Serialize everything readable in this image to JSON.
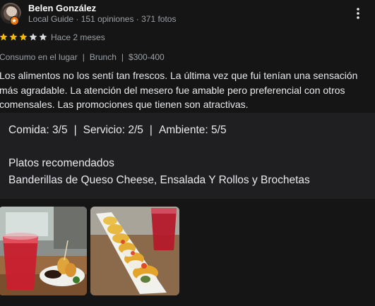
{
  "author": {
    "name": "Belen González",
    "meta": "Local Guide · 151 opiniones · 371 fotos",
    "avatar_icon": "user-avatar",
    "badge_icon": "local-guide-badge-icon",
    "badge_color": "#e8710a"
  },
  "rating": {
    "stars": 3,
    "max_stars": 5,
    "star_color": "#fbbc04",
    "empty_star_color": "#dadce0",
    "time": "Hace 2 meses"
  },
  "attributes": [
    "Consumo en el lugar",
    "Brunch",
    "$300-400"
  ],
  "attribute_separator": "|",
  "text": "Los alimentos no los sentí tan frescos. La última vez que fui tenían una sensación más agradable. La atención del mesero fue amable pero preferencial con otros comensales. Las promociones que tienen son atractivas.",
  "subratings": [
    {
      "text": "Comida: 3/5"
    },
    {
      "text": "Servicio: 2/5"
    },
    {
      "text": "Ambiente: 5/5"
    }
  ],
  "dishes": {
    "title": "Platos recomendados",
    "list": "Banderillas de Queso Cheese, Ensalada Y Rollos y Brochetas"
  },
  "photos": [
    {
      "icon": "photo-drink-and-banderillas"
    },
    {
      "icon": "photo-sushi-rolls"
    }
  ],
  "more_icon": "more-vert-icon"
}
